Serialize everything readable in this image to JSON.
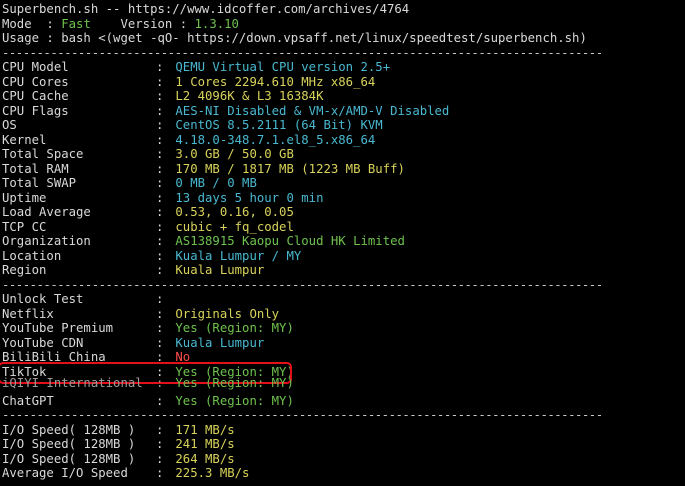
{
  "header": {
    "line1": "Superbench.sh -- https://www.idcoffer.com/archives/4764",
    "mode_label": "Mode  : ",
    "mode_value": "Fast",
    "version_label": "    Version : ",
    "version_value": "1.3.10",
    "usage": "Usage : bash <(wget -qO- https://down.vpsaff.net/linux/speedtest/superbench.sh)"
  },
  "separator": "---------------------------------------------------------------------------------------",
  "system": [
    {
      "label": "CPU Model",
      "value": "QEMU Virtual CPU version 2.5+",
      "color": "cyan"
    },
    {
      "label": "CPU Cores",
      "value": "1 Cores 2294.610 MHz x86_64",
      "color": "yellow"
    },
    {
      "label": "CPU Cache",
      "value": "L2 4096K & L3 16384K",
      "color": "yellow"
    },
    {
      "label": "CPU Flags",
      "value": "AES-NI Disabled & VM-x/AMD-V Disabled",
      "color": "cyan"
    },
    {
      "label": "OS",
      "value": "CentOS 8.5.2111 (64 Bit) KVM",
      "color": "cyan"
    },
    {
      "label": "Kernel",
      "value": "4.18.0-348.7.1.el8_5.x86_64",
      "color": "cyan"
    },
    {
      "label": "Total Space",
      "value": "3.0 GB / 50.0 GB",
      "color": "yellow"
    },
    {
      "label": "Total RAM",
      "value": "170 MB / 1817 MB (1223 MB Buff)",
      "color": "yellow"
    },
    {
      "label": "Total SWAP",
      "value": "0 MB / 0 MB",
      "color": "cyan"
    },
    {
      "label": "Uptime",
      "value": "13 days 5 hour 0 min",
      "color": "cyan"
    },
    {
      "label": "Load Average",
      "value": "0.53, 0.16, 0.05",
      "color": "yellow"
    },
    {
      "label": "TCP CC",
      "value": "cubic + fq_codel",
      "color": "yellow"
    },
    {
      "label": "Organization",
      "value": "AS138915 Kaopu Cloud HK Limited",
      "color": "green"
    },
    {
      "label": "Location",
      "value": "Kuala Lumpur / MY",
      "color": "cyan"
    },
    {
      "label": "Region",
      "value": "Kuala Lumpur",
      "color": "yellow"
    }
  ],
  "unlock": {
    "title": "Unlock Test",
    "items": [
      {
        "label": "Netflix",
        "value": "Originals Only",
        "color": "yellow"
      },
      {
        "label": "YouTube Premium",
        "value": "Yes (Region: MY)",
        "color": "green"
      },
      {
        "label": "YouTube CDN",
        "value": "Kuala Lumpur",
        "color": "cyan"
      },
      {
        "label": "BiliBili China",
        "value": "No",
        "color": "red"
      },
      {
        "label": "TikTok",
        "value": "Yes (Region: MY)",
        "color": "green",
        "highlighted": true
      },
      {
        "label": "iQIYI International",
        "value": "Yes (Region: MY)",
        "color": "green"
      },
      {
        "label": "ChatGPT",
        "value": "Yes (Region: MY)",
        "color": "green"
      }
    ]
  },
  "io": [
    {
      "label": "I/O Speed( 128MB )",
      "value": "171 MB/s"
    },
    {
      "label": "I/O Speed( 128MB )",
      "value": "241 MB/s"
    },
    {
      "label": "I/O Speed( 128MB )",
      "value": "264 MB/s"
    },
    {
      "label": "Average I/O Speed",
      "value": "225.3 MB/s"
    }
  ],
  "colors": {
    "background": "#000000",
    "text": "#d9d9d9",
    "yellow": "#d8d35a",
    "cyan": "#49b8d0",
    "green": "#6ec24e",
    "red": "#ff4b4b",
    "highlight_box": "#e3101a"
  }
}
